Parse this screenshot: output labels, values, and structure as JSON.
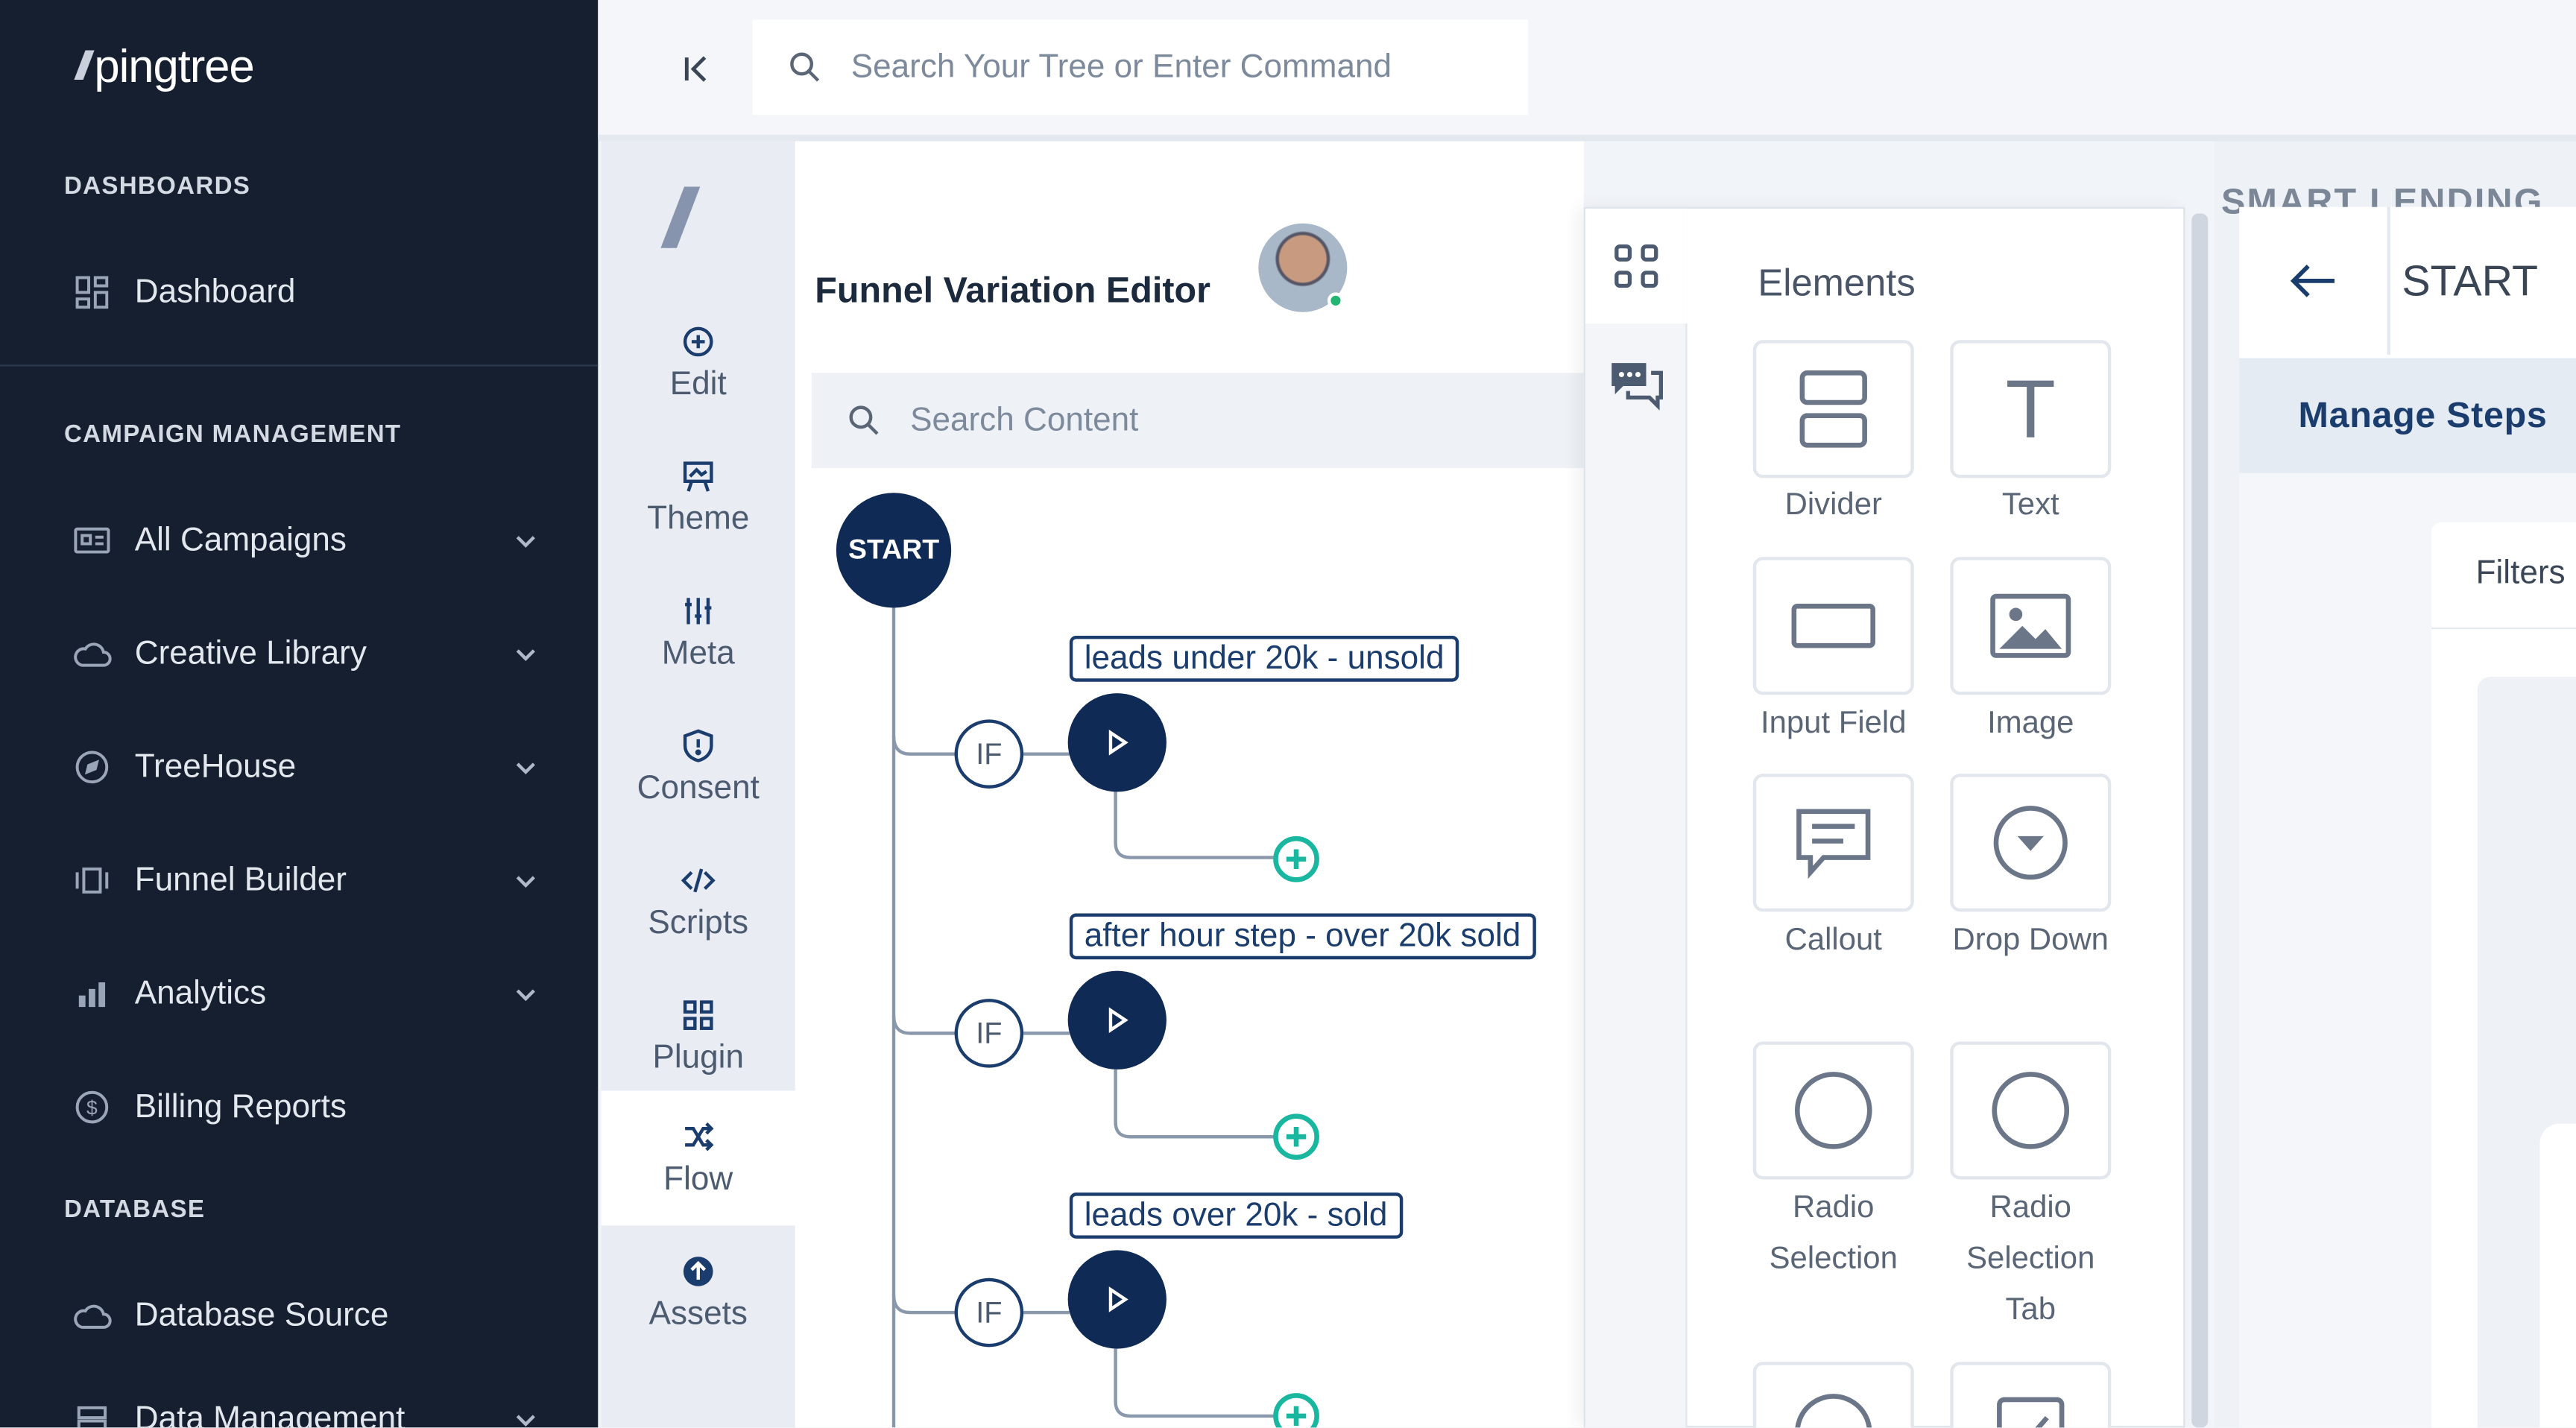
{
  "brand": {
    "logo_text": "pingtree",
    "logo_mark": "//"
  },
  "sidebar": {
    "sections": [
      {
        "title": "DASHBOARDS"
      },
      {
        "title": "CAMPAIGN MANAGEMENT"
      },
      {
        "title": "DATABASE"
      }
    ],
    "items": [
      {
        "label": "Dashboard",
        "icon": "dashboard-grid-icon",
        "chevron": false
      },
      {
        "label": "All Campaigns",
        "icon": "campaign-card-icon",
        "chevron": true
      },
      {
        "label": "Creative Library",
        "icon": "cloud-icon",
        "chevron": true
      },
      {
        "label": "TreeHouse",
        "icon": "compass-icon",
        "chevron": true
      },
      {
        "label": "Funnel Builder",
        "icon": "funnel-carousel-icon",
        "chevron": true
      },
      {
        "label": "Analytics",
        "icon": "bar-chart-icon",
        "chevron": true
      },
      {
        "label": "Billing Reports",
        "icon": "dollar-circle-icon",
        "chevron": false
      },
      {
        "label": "Database Source",
        "icon": "cloud-icon",
        "chevron": false
      },
      {
        "label": "Data Management",
        "icon": "server-icon",
        "chevron": true
      }
    ]
  },
  "topbar": {
    "search_placeholder": "Search Your Tree or Enter Command"
  },
  "rail": {
    "items": [
      {
        "label": "Edit",
        "icon": "plus-circle-icon"
      },
      {
        "label": "Theme",
        "icon": "easel-icon"
      },
      {
        "label": "Meta",
        "icon": "sliders-icon"
      },
      {
        "label": "Consent",
        "icon": "shield-alert-icon"
      },
      {
        "label": "Scripts",
        "icon": "code-icon"
      },
      {
        "label": "Plugin",
        "icon": "plugin-grid-icon"
      },
      {
        "label": "Flow",
        "icon": "shuffle-icon",
        "active": true
      },
      {
        "label": "Assets",
        "icon": "upload-circle-icon"
      }
    ]
  },
  "editor": {
    "title": "Funnel Variation Editor",
    "content_search_placeholder": "Search Content",
    "start_label": "START",
    "branches": [
      {
        "condition": "IF",
        "label": "leads under 20k - unsold"
      },
      {
        "condition": "IF",
        "label": "after hour step - over 20k sold"
      },
      {
        "condition": "IF",
        "label": "leads over 20k - sold"
      }
    ]
  },
  "elements_panel": {
    "title": "Elements",
    "items": [
      {
        "label": "Divider",
        "icon": "divider-icon"
      },
      {
        "label": "Text",
        "icon": "text-t-icon"
      },
      {
        "label": "Input Field",
        "icon": "input-field-icon"
      },
      {
        "label": "Image",
        "icon": "image-icon"
      },
      {
        "label": "Callout",
        "icon": "callout-icon"
      },
      {
        "label": "Drop Down",
        "icon": "dropdown-icon"
      },
      {
        "label": "Radio Selection",
        "icon": "radio-circle-icon"
      },
      {
        "label": "Radio Selection Tab",
        "icon": "radio-circle-icon"
      }
    ]
  },
  "right_panel": {
    "heading": "SMART LENDING",
    "title": "START",
    "manage_steps_label": "Manage Steps",
    "filters_label": "Filters"
  },
  "colors": {
    "sidebar_bg": "#161f2f",
    "primary_navy": "#0f2a55",
    "add_teal": "#19b7a0"
  }
}
